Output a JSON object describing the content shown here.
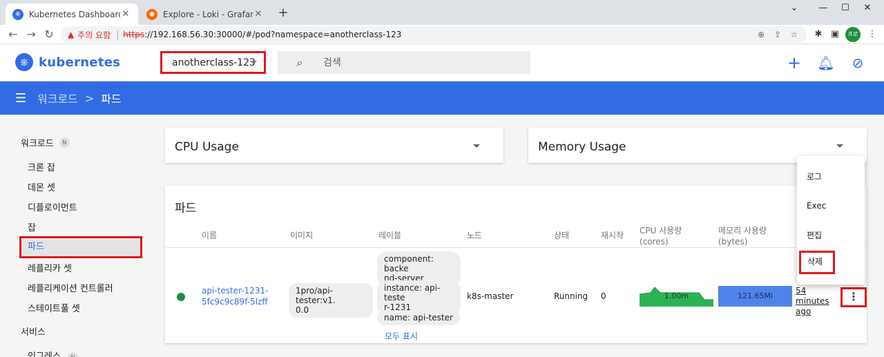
{
  "browser": {
    "tabs": [
      {
        "title": "Kubernetes Dashboard",
        "favicon": "kubernetes-icon"
      },
      {
        "title": "Explore - Loki - Grafana",
        "favicon": "grafana-icon"
      }
    ],
    "new_tab": "+",
    "address": {
      "warning_label": "주의 요함",
      "url_scheme": "https",
      "url_rest": "://192.168.56.30:30000/#/pod?namespace=anotherclass-123"
    },
    "profile_label": "프로"
  },
  "header": {
    "brand": "kubernetes",
    "namespace": "anotherclass-123",
    "search_placeholder": "검색"
  },
  "breadcrumb": {
    "parent": "워크로드",
    "separator": ">",
    "current": "파드"
  },
  "sidebar": {
    "workloads": {
      "label": "워크로드",
      "badge": "N"
    },
    "items": [
      "크론 잡",
      "데몬 셋",
      "디플로이먼트",
      "잡",
      "파드",
      "레플리카 셋",
      "레플리케이션 컨트롤러",
      "스테이트풀 셋"
    ],
    "services": {
      "label": "서비스"
    },
    "ingress": {
      "label": "인그레스",
      "badge": "N"
    }
  },
  "cards": {
    "cpu_title": "CPU Usage",
    "memory_title": "Memory Usage",
    "pods_title": "파드"
  },
  "table": {
    "headers": {
      "name": "이름",
      "image": "이미지",
      "labels": "레이블",
      "node": "노드",
      "status": "상태",
      "restarts": "재시작",
      "cpu": "CPU 사용량",
      "cpu_unit": "(cores)",
      "memory": "메모리 사용량",
      "memory_unit": "(bytes)"
    },
    "row": {
      "name_line1": "api-tester-1231-",
      "name_line2": "5fc9c9c89f-5lzff",
      "image_line1": "1pro/api-tester:v1.",
      "image_line2": "0.0",
      "labels": [
        {
          "l1": "component: backe",
          "l2": "nd-server"
        },
        {
          "l1": "instance: api-teste",
          "l2": "r-1231"
        },
        {
          "l1": "name: api-tester",
          "l2": ""
        }
      ],
      "show_all": "모두 표시",
      "node": "k8s-master",
      "status": "Running",
      "restarts": "0",
      "cpu_value": "1.00m",
      "memory_value": "121.65Mi",
      "age_line1": "54 minutes",
      "age_line2": "ago"
    }
  },
  "context_menu": [
    "로그",
    "Exec",
    "편집",
    "삭제"
  ],
  "colors": {
    "brand_blue": "#326ce5",
    "highlight_red": "#e0161e",
    "running_green": "#1e8e3e"
  }
}
